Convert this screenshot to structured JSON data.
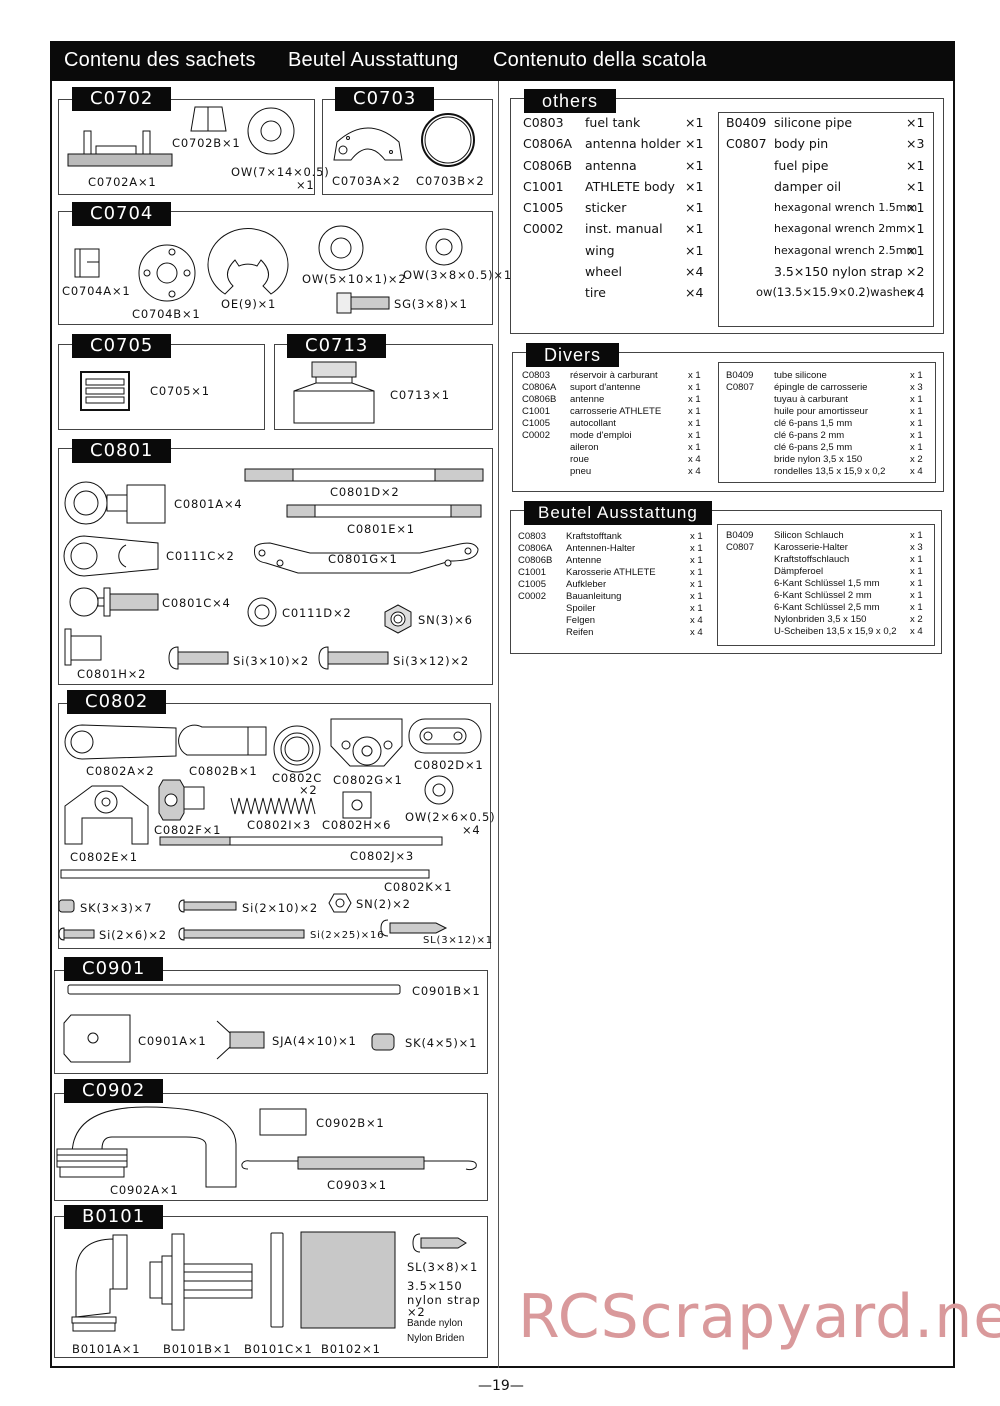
{
  "header": {
    "title_fr": "Contenu des sachets",
    "title_de": "Beutel Ausstattung",
    "title_it": "Contenuto della scatola"
  },
  "bags": {
    "c0702": {
      "tag": "C0702",
      "parts": [
        "C0702A×1",
        "C0702B×1",
        "OW(7×14×0.5)",
        "×1"
      ]
    },
    "c0703": {
      "tag": "C0703",
      "parts": [
        "C0703A×2",
        "C0703B×2"
      ]
    },
    "c0704": {
      "tag": "C0704",
      "parts": [
        "C0704A×1",
        "C0704B×1",
        "OE(9)×1",
        "OW(5×10×1)×2",
        "OW(3×8×0.5)×1",
        "SG(3×8)×1"
      ]
    },
    "c0705": {
      "tag": "C0705",
      "parts": [
        "C0705×1"
      ]
    },
    "c0713": {
      "tag": "C0713",
      "parts": [
        "C0713×1"
      ]
    },
    "c0801": {
      "tag": "C0801",
      "parts": [
        "C0801A×4",
        "C0801D×2",
        "C0801E×1",
        "C0111C×2",
        "C0801G×1",
        "C0801C×4",
        "C0111D×2",
        "SN(3)×6",
        "C0801H×2",
        "Si(3×10)×2",
        "Si(3×12)×2"
      ]
    },
    "c0802": {
      "tag": "C0802",
      "parts": [
        "C0802A×2",
        "C0802B×1",
        "C0802C",
        "×2",
        "C0802G×1",
        "C0802D×1",
        "C0802E×1",
        "C0802F×1",
        "C0802I×3",
        "C0802H×6",
        "OW(2×6×0.5)",
        "×4",
        "C0802J×3",
        "C0802K×1",
        "SK(3×3)×7",
        "Si(2×10)×2",
        "SN(2)×2",
        "Si(2×6)×2",
        "Si(2×25)×16",
        "SL(3×12)×1"
      ]
    },
    "c0901": {
      "tag": "C0901",
      "parts": [
        "C0901B×1",
        "C0901A×1",
        "SJA(4×10)×1",
        "SK(4×5)×1"
      ]
    },
    "c0902": {
      "tag": "C0902",
      "parts": [
        "C0902B×1",
        "C0902A×1",
        "C0903×1"
      ]
    },
    "b0101": {
      "tag": "B0101",
      "parts": [
        "B0101A×1",
        "B0101B×1",
        "B0101C×1",
        "B0102×1",
        "SL(3×8)×1",
        "3.5×150",
        "nylon strap",
        "×2",
        "Bande nylon",
        "Nylon Briden"
      ]
    }
  },
  "others": {
    "title": "others",
    "left": [
      {
        "code": "C0803",
        "name": "fuel tank",
        "qty": "×1"
      },
      {
        "code": "C0806A",
        "name": "antenna holder",
        "qty": "×1"
      },
      {
        "code": "C0806B",
        "name": "antenna",
        "qty": "×1"
      },
      {
        "code": "C1001",
        "name": "ATHLETE body",
        "qty": "×1"
      },
      {
        "code": "C1005",
        "name": "sticker",
        "qty": "×1"
      },
      {
        "code": "C0002",
        "name": "inst. manual",
        "qty": "×1"
      },
      {
        "code": "",
        "name": "wing",
        "qty": "×1"
      },
      {
        "code": "",
        "name": "wheel",
        "qty": "×4"
      },
      {
        "code": "",
        "name": "tire",
        "qty": "×4"
      }
    ],
    "right": [
      {
        "code": "B0409",
        "name": "silicone pipe",
        "qty": "×1"
      },
      {
        "code": "C0807",
        "name": "body pin",
        "qty": "×3"
      },
      {
        "code": "",
        "name": "fuel pipe",
        "qty": "×1"
      },
      {
        "code": "",
        "name": "damper oil",
        "qty": "×1"
      },
      {
        "code": "",
        "name": "hexagonal wrench 1.5mm",
        "qty": "×1"
      },
      {
        "code": "",
        "name": "hexagonal wrench 2mm",
        "qty": "×1"
      },
      {
        "code": "",
        "name": "hexagonal wrench 2.5mm",
        "qty": "×1"
      },
      {
        "code": "",
        "name": "3.5×150 nylon strap",
        "qty": "×2"
      },
      {
        "code": "",
        "name": "ow(13.5×15.9×0.2)washer",
        "qty": "×4"
      }
    ]
  },
  "divers": {
    "title": "Divers",
    "left": [
      {
        "code": "C0803",
        "name": "réservoir à carburant",
        "qty": "x 1"
      },
      {
        "code": "C0806A",
        "name": "suport d'antenne",
        "qty": "x 1"
      },
      {
        "code": "C0806B",
        "name": "antenne",
        "qty": "x 1"
      },
      {
        "code": "C1001",
        "name": "carrosserie ATHLETE",
        "qty": "x 1"
      },
      {
        "code": "C1005",
        "name": "autocollant",
        "qty": "x 1"
      },
      {
        "code": "C0002",
        "name": "mode d'emploi",
        "qty": "x 1"
      },
      {
        "code": "",
        "name": "aileron",
        "qty": "x 1"
      },
      {
        "code": "",
        "name": "roue",
        "qty": "x 4"
      },
      {
        "code": "",
        "name": "pneu",
        "qty": "x 4"
      }
    ],
    "right": [
      {
        "code": "B0409",
        "name": "tube silicone",
        "qty": "x 1"
      },
      {
        "code": "C0807",
        "name": "épingle de carrosserie",
        "qty": "x 3"
      },
      {
        "code": "",
        "name": "tuyau à carburant",
        "qty": "x 1"
      },
      {
        "code": "",
        "name": "huile pour amortisseur",
        "qty": "x 1"
      },
      {
        "code": "",
        "name": "clé 6-pans 1,5 mm",
        "qty": "x 1"
      },
      {
        "code": "",
        "name": "clé 6-pans 2 mm",
        "qty": "x 1"
      },
      {
        "code": "",
        "name": "clé 6-pans 2,5 mm",
        "qty": "x 1"
      },
      {
        "code": "",
        "name": "bride nylon 3,5 x 150",
        "qty": "x 2"
      },
      {
        "code": "",
        "name": "rondelles 13,5 x 15,9 x 0,2",
        "qty": "x 4"
      }
    ]
  },
  "beutel": {
    "title": "Beutel Ausstattung",
    "left": [
      {
        "code": "C0803",
        "name": "Kraftstofftank",
        "qty": "x 1"
      },
      {
        "code": "C0806A",
        "name": "Antennen-Halter",
        "qty": "x 1"
      },
      {
        "code": "C0806B",
        "name": "Antenne",
        "qty": "x 1"
      },
      {
        "code": "C1001",
        "name": "Karosserie ATHLETE",
        "qty": "x 1"
      },
      {
        "code": "C1005",
        "name": "Aufkleber",
        "qty": "x 1"
      },
      {
        "code": "C0002",
        "name": "Bauanleitung",
        "qty": "x 1"
      },
      {
        "code": "",
        "name": "Spoiler",
        "qty": "x 1"
      },
      {
        "code": "",
        "name": "Felgen",
        "qty": "x 4"
      },
      {
        "code": "",
        "name": "Reifen",
        "qty": "x 4"
      }
    ],
    "right": [
      {
        "code": "B0409",
        "name": "Silicon Schlauch",
        "qty": "x 1"
      },
      {
        "code": "C0807",
        "name": "Karosserie-Halter",
        "qty": "x 3"
      },
      {
        "code": "",
        "name": "Kraftstoffschlauch",
        "qty": "x 1"
      },
      {
        "code": "",
        "name": "Dämpferoel",
        "qty": "x 1"
      },
      {
        "code": "",
        "name": "6-Kant Schlüssel 1,5 mm",
        "qty": "x 1"
      },
      {
        "code": "",
        "name": "6-Kant Schlüssel 2 mm",
        "qty": "x 1"
      },
      {
        "code": "",
        "name": "6-Kant Schlüssel 2,5 mm",
        "qty": "x 1"
      },
      {
        "code": "",
        "name": "Nylonbriden 3,5 x 150",
        "qty": "x 2"
      },
      {
        "code": "",
        "name": "U-Scheiben 13,5 x 15,9 x 0,2",
        "qty": "x 4"
      }
    ]
  },
  "watermark": "RCScrapyard.net",
  "page_number": "—19—"
}
